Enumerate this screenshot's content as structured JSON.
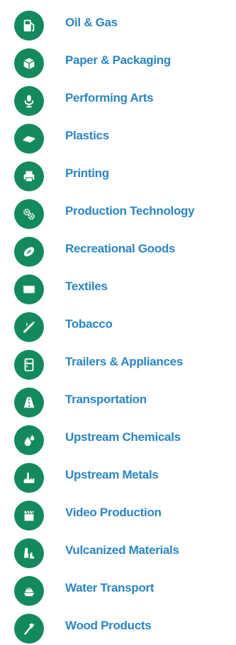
{
  "accent_color": "#138a5d",
  "link_color": "#2a86c4",
  "industries": [
    {
      "label": "Oil & Gas",
      "icon": "fuel-pump-icon"
    },
    {
      "label": "Paper & Packaging",
      "icon": "box-icon"
    },
    {
      "label": "Performing Arts",
      "icon": "microphone-icon"
    },
    {
      "label": "Plastics",
      "icon": "plastic-sheet-icon"
    },
    {
      "label": "Printing",
      "icon": "printer-icon"
    },
    {
      "label": "Production Technology",
      "icon": "gears-icon"
    },
    {
      "label": "Recreational Goods",
      "icon": "football-icon"
    },
    {
      "label": "Textiles",
      "icon": "fabric-icon"
    },
    {
      "label": "Tobacco",
      "icon": "cigarette-icon"
    },
    {
      "label": "Trailers & Appliances",
      "icon": "refrigerator-icon"
    },
    {
      "label": "Transportation",
      "icon": "road-icon"
    },
    {
      "label": "Upstream Chemicals",
      "icon": "droplets-icon"
    },
    {
      "label": "Upstream Metals",
      "icon": "factory-icon"
    },
    {
      "label": "Video Production",
      "icon": "clapperboard-icon"
    },
    {
      "label": "Vulcanized Materials",
      "icon": "boots-icon"
    },
    {
      "label": "Water Transport",
      "icon": "ship-icon"
    },
    {
      "label": "Wood Products",
      "icon": "axe-icon"
    }
  ]
}
